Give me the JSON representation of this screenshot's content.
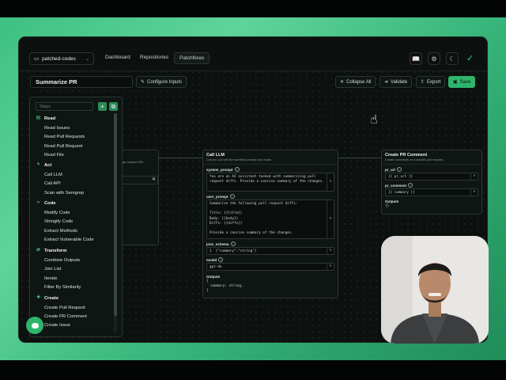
{
  "nav": {
    "project": "patched-codes",
    "links": [
      "Dashboard",
      "Repositories",
      "Patchflows"
    ]
  },
  "toolbar": {
    "flow_name": "Summarize PR",
    "configure": "Configure Inputs",
    "collapse": "Collapse All",
    "validate": "Validate",
    "export": "Export",
    "save": "Save"
  },
  "steps_panel": {
    "search_placeholder": "Steps",
    "categories": [
      {
        "name": "Read",
        "items": [
          "Read Issues",
          "Read Pull Requests",
          "Read Pull Request",
          "Read File"
        ]
      },
      {
        "name": "Act",
        "items": [
          "Call LLM",
          "Call API",
          "Scan with Semgrep"
        ]
      },
      {
        "name": "Code",
        "items": [
          "Modify Code",
          "Stringify Code",
          "Extract Methods",
          "Extract Vulnerable Code"
        ]
      },
      {
        "name": "Transform",
        "items": [
          "Combine Outputs",
          "Join List",
          "Iterate",
          "Filter By Similarity"
        ]
      },
      {
        "name": "Create",
        "items": [
          "Create Pull Request",
          "Create PR Comment",
          "Create Issue"
        ]
      }
    ]
  },
  "node_left": {
    "desc": "ge request URL."
  },
  "node_llm": {
    "title": "Call LLM",
    "desc": "Call an LLM with the specified prompt and model.",
    "system_prompt_label": "system_prompt",
    "system_prompt": "You are an AI assistant tasked with summarizing pull request diffs. Provide a concise summary of the changes.",
    "user_prompt_label": "user_prompt",
    "user_prompt": "Summarize the following pull request diffs:\n\nTitle: {{title}}\nBody: {{body}}\nDiffs: {{diffs}}\n\nProvide a concise summary of the changes.",
    "json_schema_label": "json_schema",
    "json_schema": "1  {\"summary\":\"string\"}",
    "model_label": "model",
    "model": "gpt-4o",
    "outputs_label": "Outputs",
    "outputs": "{\n  summary: string,\n}"
  },
  "node_comment": {
    "title": "Create PR Comment",
    "desc": "Create comments on a specific pull request.",
    "pr_url_label": "pr_url",
    "pr_url": "{{ pr_url }}",
    "pr_comment_label": "pr_comment",
    "pr_comment": "{{ summary }}",
    "outputs_label": "Outputs",
    "outputs": "{}"
  },
  "colors": {
    "accent": "#2fb56b",
    "background": "#0c110f"
  }
}
